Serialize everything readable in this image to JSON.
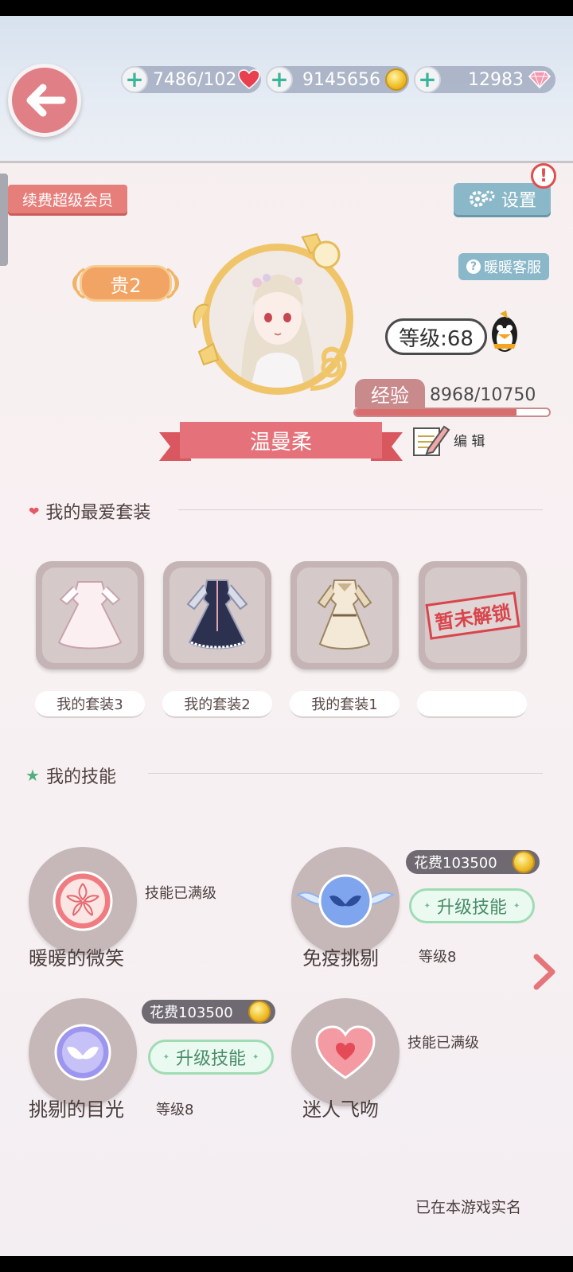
{
  "header": {
    "stamina": "7486/102",
    "gold": "9145656",
    "diamonds": "12983"
  },
  "top_actions": {
    "renew_vip": "续费超级会员",
    "settings": "设置",
    "service": "暖暖客服"
  },
  "profile": {
    "vip_level": "贵2",
    "level": "等级:68",
    "exp_label": "经验",
    "exp_value": "8968/10750",
    "exp_fraction": 0.834,
    "name": "温曼柔",
    "edit": "编 辑"
  },
  "favorites": {
    "title": "我的最爱套装",
    "items": [
      {
        "label": "我的套装3"
      },
      {
        "label": "我的套装2"
      },
      {
        "label": "我的套装1"
      },
      {
        "label": "",
        "locked": "暂未解锁"
      }
    ]
  },
  "skills": {
    "title": "我的技能",
    "list": [
      {
        "name": "暖暖的微笑",
        "status": "技能已满级",
        "icon": "sakura-icon"
      },
      {
        "name": "免疫挑剔",
        "level": "等级8",
        "cost": "花费103500",
        "upgrade": "升级技能",
        "icon": "winged-mask-icon"
      },
      {
        "name": "挑剔的目光",
        "level": "等级8",
        "cost": "花费103500",
        "upgrade": "升级技能",
        "icon": "mask-icon"
      },
      {
        "name": "迷人飞吻",
        "status": "技能已满级",
        "icon": "heart-icon"
      }
    ]
  },
  "footer": {
    "realname": "已在本游戏实名"
  }
}
